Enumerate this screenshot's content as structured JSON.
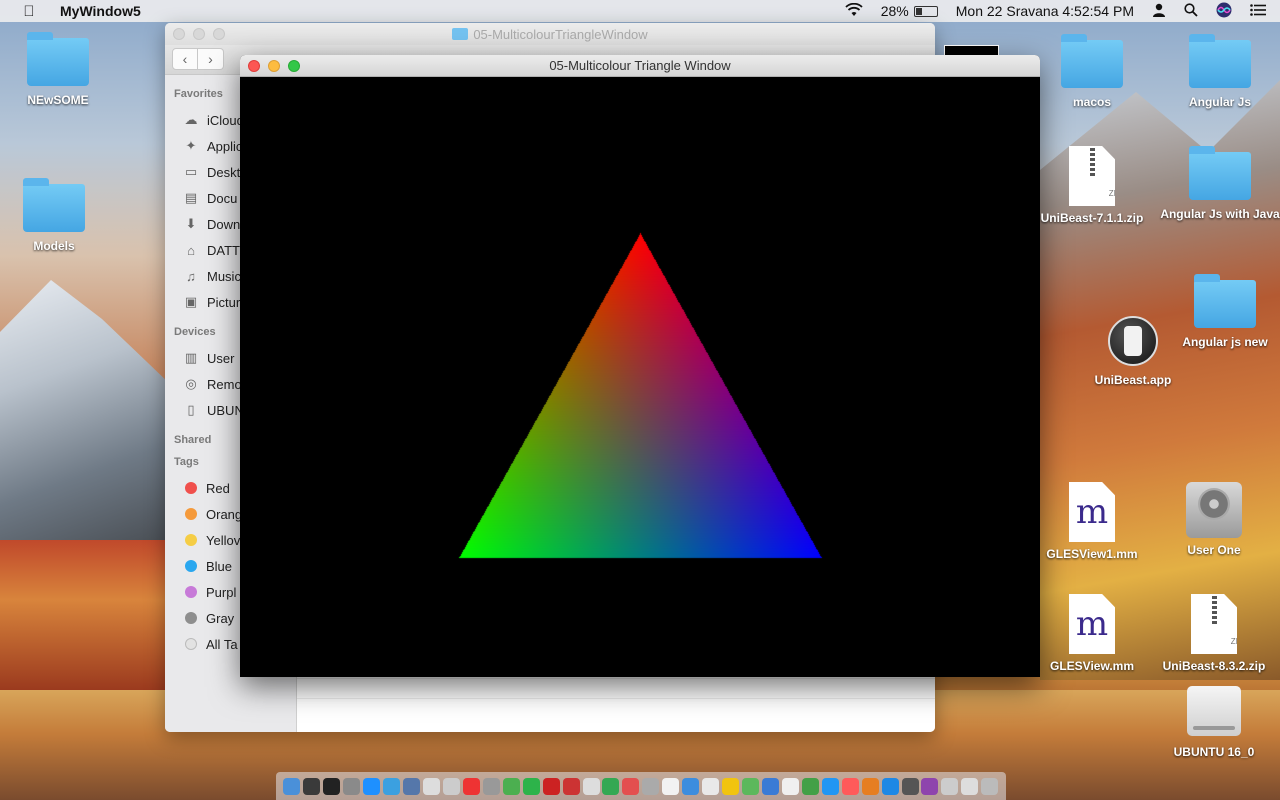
{
  "menubar": {
    "apple_icon": "apple-logo",
    "app_name": "MyWindow5",
    "battery_percent": "28%",
    "battery_level": 0.28,
    "datetime": "Mon 22 Sravana  4:52:54 PM"
  },
  "finder": {
    "title": "05-MulticolourTriangleWindow",
    "back_icon": "chevron-left",
    "forward_icon": "chevron-right",
    "favorites_title": "Favorites",
    "favorites": [
      {
        "label": "iCloud",
        "icon": "cloud-icon"
      },
      {
        "label": "Applic",
        "icon": "applications-icon"
      },
      {
        "label": "Deskt",
        "icon": "desktop-icon"
      },
      {
        "label": "Docu",
        "icon": "document-icon"
      },
      {
        "label": "Down",
        "icon": "download-icon"
      },
      {
        "label": "DATT",
        "icon": "home-icon"
      },
      {
        "label": "Music",
        "icon": "music-icon"
      },
      {
        "label": "Pictur",
        "icon": "camera-icon"
      }
    ],
    "devices_title": "Devices",
    "devices": [
      {
        "label": "User",
        "icon": "disk-icon"
      },
      {
        "label": "Remo",
        "icon": "cd-icon"
      },
      {
        "label": "UBUN",
        "icon": "drive-icon"
      }
    ],
    "shared_title": "Shared",
    "tags_title": "Tags",
    "tags": [
      {
        "label": "Red",
        "color": "#f0504c"
      },
      {
        "label": "Orang",
        "color": "#f59a3b"
      },
      {
        "label": "Yellov",
        "color": "#f5cd45"
      },
      {
        "label": "Blue",
        "color": "#2aa7ef"
      },
      {
        "label": "Purpl",
        "color": "#c77ad8"
      },
      {
        "label": "Gray",
        "color": "#8e8e8e"
      },
      {
        "label": "All Ta",
        "color": "#e2e2e2"
      }
    ]
  },
  "gl_window": {
    "title": "05-Multicolour Triangle Window",
    "triangle_colors": {
      "top": "#ff0000",
      "left": "#00ff00",
      "right": "#0000ff"
    }
  },
  "desktop_left": [
    {
      "label": "NEwSOME",
      "icon": "folder-icon"
    },
    {
      "label": "Models",
      "icon": "folder-icon"
    }
  ],
  "desktop_right": {
    "macos": "macos",
    "angular_js": "Angular Js",
    "unibeast_zip": "UniBeast-7.1.1.zip",
    "angular_js_java": "Angular Js with Java",
    "unibeast_app": "UniBeast.app",
    "angular_js_new": "Angular js new",
    "glesview1": "GLESView1.mm",
    "user_one": "User One",
    "glesview": "GLESView.mm",
    "unibeast_zip2": "UniBeast-8.3.2.zip",
    "ubuntu": "UBUNTU 16_0",
    "zip_badge": "ZIP",
    "mm_glyph": "m"
  },
  "dock_colors": [
    "#4a90d9",
    "#3a3a3a",
    "#222222",
    "#8a8a8a",
    "#1e90ff",
    "#3ba0e0",
    "#5577aa",
    "#dddddd",
    "#cccccc",
    "#ee3333",
    "#999999",
    "#4caf50",
    "#2db34a",
    "#cc2222",
    "#cc3333",
    "#dddddd",
    "#34a853",
    "#e34f4f",
    "#aaaaaa",
    "#f2f2f2",
    "#3c8dde",
    "#e9e9e9",
    "#f1c40f",
    "#5cb85c",
    "#3a7bd5",
    "#f0f0f0",
    "#43a047",
    "#2196f3",
    "#ff5a5a",
    "#e67e22",
    "#1e88e5",
    "#555555",
    "#8e44ad",
    "#cccccc",
    "#dddddd",
    "#bbbbbb"
  ]
}
